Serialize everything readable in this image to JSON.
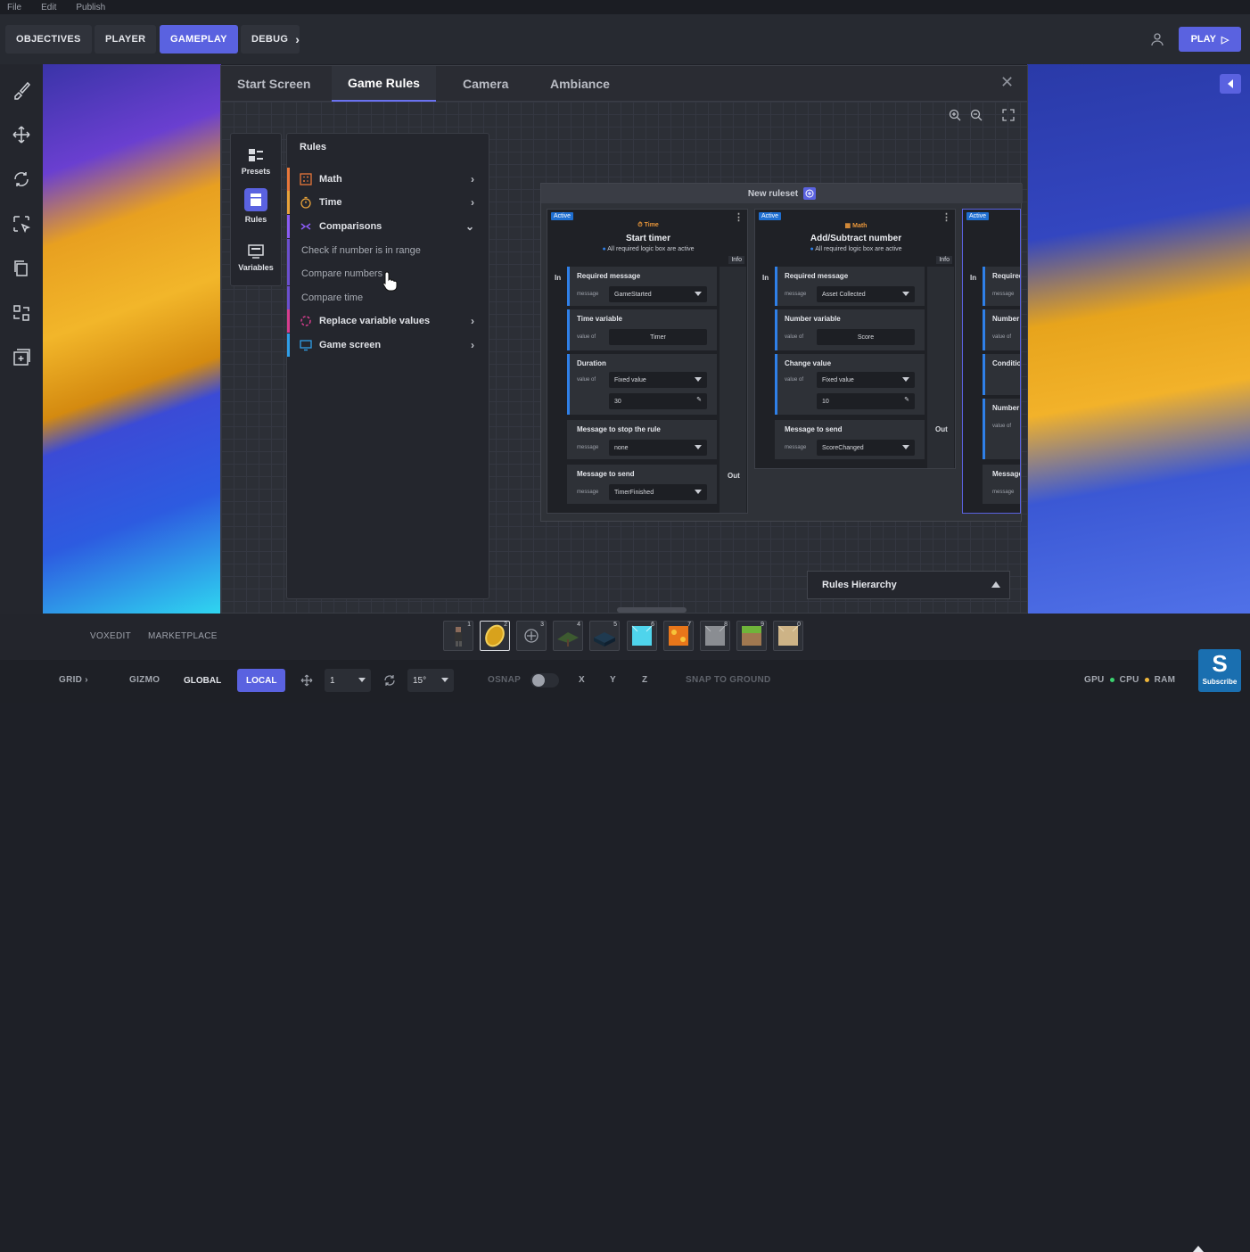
{
  "menu": {
    "items": [
      "File",
      "Edit",
      "Publish"
    ]
  },
  "nav": {
    "objectives": "OBJECTIVES",
    "player": "PLAYER",
    "gameplay": "GAMEPLAY",
    "debug": "DEBUG",
    "play": "PLAY"
  },
  "modal": {
    "tabs": [
      "Start Screen",
      "Game Rules",
      "Camera",
      "Ambiance"
    ],
    "active_tab": "Game Rules"
  },
  "sidenav": {
    "presets": "Presets",
    "rules": "Rules",
    "variables": "Variables"
  },
  "rules": {
    "title": "Rules",
    "categories": [
      {
        "label": "Math",
        "color": "#e8773a"
      },
      {
        "label": "Time",
        "color": "#e8a23a"
      },
      {
        "label": "Comparisons",
        "color": "#8b5cf6"
      },
      {
        "label": "Replace variable values",
        "color": "#d63d8e"
      },
      {
        "label": "Game screen",
        "color": "#2f9ee8"
      }
    ],
    "comparison_items": [
      "Check if number is in range",
      "Compare numbers",
      "Compare time"
    ]
  },
  "ruleset": {
    "title": "New ruleset",
    "cards": [
      {
        "status": "Active",
        "category": "Time",
        "title": "Start timer",
        "requirement": "All required logic box are active",
        "info": "Info",
        "in": "In",
        "out": "Out",
        "fields": [
          {
            "label": "Required message",
            "key": "message",
            "value": "GameStarted"
          },
          {
            "label": "Time variable",
            "key": "value of",
            "value": "Timer"
          },
          {
            "label": "Duration",
            "key": "value of",
            "value": "Fixed value",
            "extra": "30"
          },
          {
            "label": "Message to stop the rule",
            "key": "message",
            "value": "none"
          },
          {
            "label": "Message to send",
            "key": "message",
            "value": "TimerFinished"
          }
        ]
      },
      {
        "status": "Active",
        "category": "Math",
        "title": "Add/Subtract number",
        "requirement": "All required logic box are active",
        "info": "Info",
        "in": "In",
        "out": "Out",
        "fields": [
          {
            "label": "Required message",
            "key": "message",
            "value": "Asset Collected"
          },
          {
            "label": "Number variable",
            "key": "value of",
            "value": "Score"
          },
          {
            "label": "Change value",
            "key": "value of",
            "value": "Fixed value",
            "extra": "10"
          },
          {
            "label": "Message to send",
            "key": "message",
            "value": "ScoreChanged"
          }
        ]
      },
      {
        "status": "Active",
        "in": "In",
        "fields": [
          {
            "label": "Required",
            "key": "message"
          },
          {
            "label": "Number",
            "key": "value of"
          },
          {
            "label": "Conditio"
          },
          {
            "label": "Number",
            "key": "value of"
          },
          {
            "label": "Message",
            "key": "message"
          }
        ]
      }
    ]
  },
  "hierarchy": {
    "label": "Rules Hierarchy"
  },
  "assetbar": {
    "tabs": [
      "VOXEDIT",
      "MARKETPLACE"
    ],
    "slot_numbers": [
      "1",
      "2",
      "3",
      "4",
      "5",
      "6",
      "7",
      "8",
      "9",
      "0"
    ]
  },
  "bottombar": {
    "grid": "GRID",
    "gizmo": "GIZMO",
    "global": "GLOBAL",
    "local": "LOCAL",
    "move_step": "1",
    "rotate_step": "15°",
    "osnap": "OSNAP",
    "x": "X",
    "y": "Y",
    "z": "Z",
    "snap_to_ground": "SNAP TO GROUND",
    "gpu": "GPU",
    "cpu": "CPU",
    "ram": "RAM"
  },
  "subscribe": {
    "letter": "S",
    "label": "Subscribe"
  }
}
